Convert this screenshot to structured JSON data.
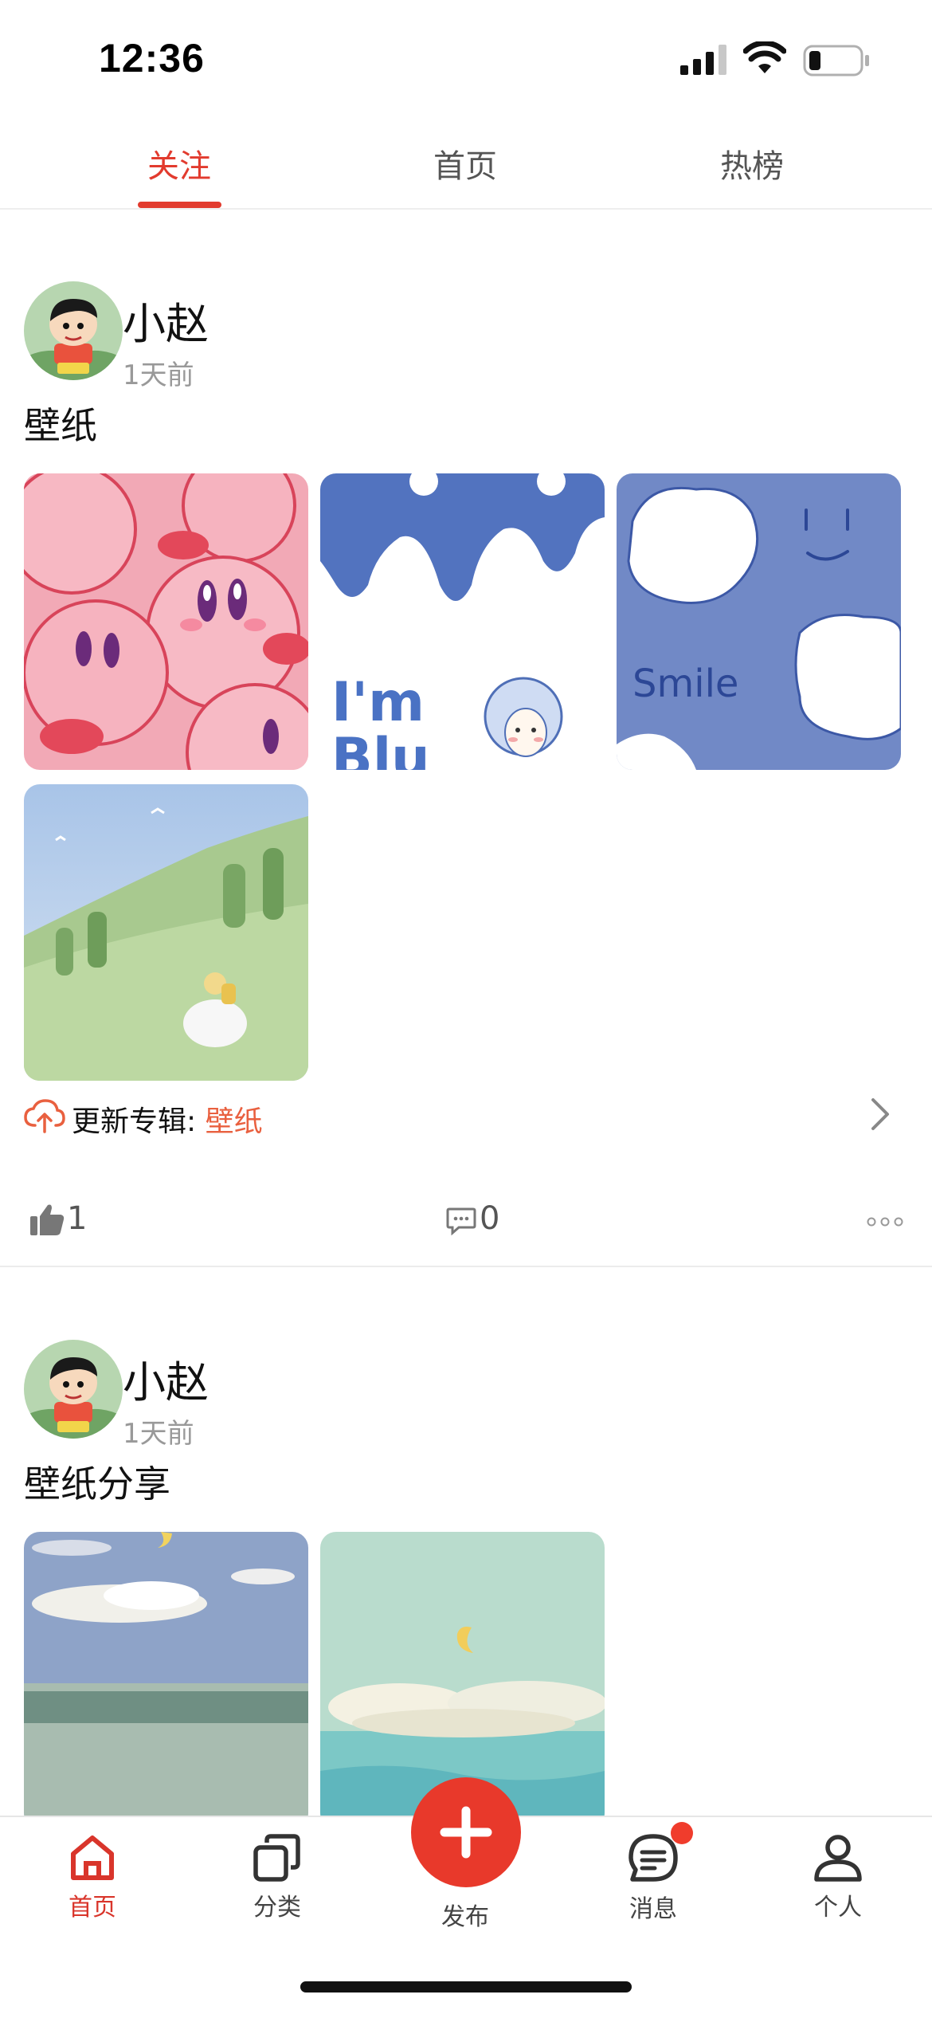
{
  "status_bar": {
    "time": "12:36",
    "signal_bars_filled": 3,
    "battery_level": 0.15
  },
  "top_tabs": [
    {
      "label": "关注",
      "active": true
    },
    {
      "label": "首页",
      "active": false
    },
    {
      "label": "热榜",
      "active": false
    }
  ],
  "posts": [
    {
      "author": "小赵",
      "time": "1天前",
      "title": "壁纸",
      "images": [
        "kirby-pattern",
        "im-blue-girl",
        "smile-clouds",
        "girl-in-meadow"
      ],
      "album_prefix": "更新专辑: ",
      "album_name": "壁纸",
      "likes": "1",
      "comments": "0"
    },
    {
      "author": "小赵",
      "time": "1天前",
      "title": "壁纸分享",
      "images": [
        "sky-clouds-moon",
        "sea-clouds-moon"
      ]
    }
  ],
  "bottom_nav": {
    "items": [
      {
        "label": "首页",
        "icon": "home-icon",
        "active": true
      },
      {
        "label": "分类",
        "icon": "layers-icon",
        "active": false
      },
      {
        "label": "发布",
        "icon": "plus-icon",
        "active": false
      },
      {
        "label": "消息",
        "icon": "message-icon",
        "active": false,
        "badge": true
      },
      {
        "label": "个人",
        "icon": "person-icon",
        "active": false
      }
    ]
  },
  "colors": {
    "accent": "#e23b2e",
    "album_link": "#e9603f",
    "muted": "#999999"
  }
}
